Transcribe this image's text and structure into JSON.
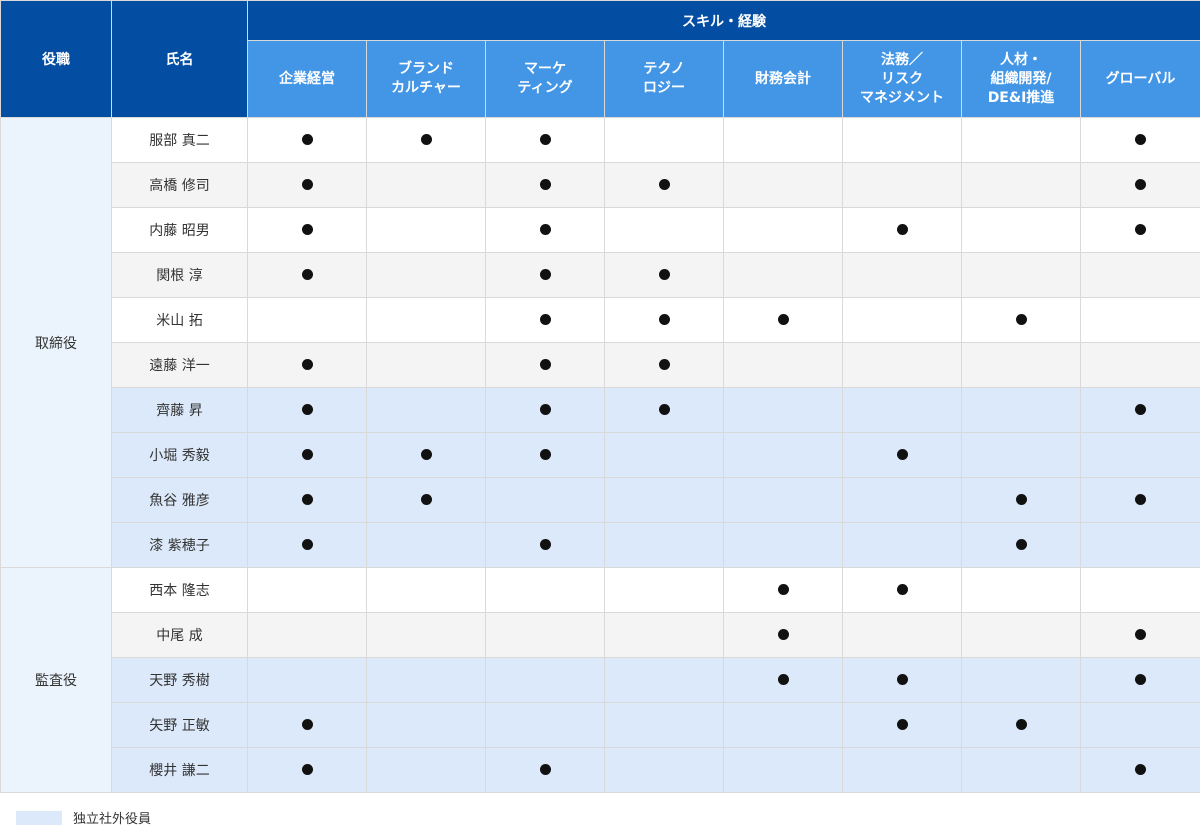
{
  "header": {
    "role_label": "役職",
    "name_label": "氏名",
    "group_label": "スキル・経験",
    "skills": [
      [
        "企業経営"
      ],
      [
        "ブランド",
        "カルチャー"
      ],
      [
        "マーケ",
        "ティング"
      ],
      [
        "テクノ",
        "ロジー"
      ],
      [
        "財務会計"
      ],
      [
        "法務／",
        "リスク",
        "マネジメント"
      ],
      [
        "人材・",
        "組織開発/",
        "DE&I推進"
      ],
      [
        "グローバル"
      ]
    ]
  },
  "mark_symbol": "●",
  "colors": {
    "header_dark": "#034ea2",
    "header_light": "#4396e6",
    "independent_fill": "#dce9fa",
    "role_fill": "#ebf4fd",
    "stripe_fill": "#f4f4f4"
  },
  "groups": [
    {
      "role": "取締役",
      "members": [
        {
          "name": "服部 真二",
          "independent": false,
          "skills": [
            1,
            1,
            1,
            0,
            0,
            0,
            0,
            1
          ]
        },
        {
          "name": "高橋 修司",
          "independent": false,
          "skills": [
            1,
            0,
            1,
            1,
            0,
            0,
            0,
            1
          ]
        },
        {
          "name": "内藤 昭男",
          "independent": false,
          "skills": [
            1,
            0,
            1,
            0,
            0,
            1,
            0,
            1
          ]
        },
        {
          "name": "関根 淳",
          "independent": false,
          "skills": [
            1,
            0,
            1,
            1,
            0,
            0,
            0,
            0
          ]
        },
        {
          "name": "米山 拓",
          "independent": false,
          "skills": [
            0,
            0,
            1,
            1,
            1,
            0,
            1,
            0
          ]
        },
        {
          "name": "遠藤 洋一",
          "independent": false,
          "skills": [
            1,
            0,
            1,
            1,
            0,
            0,
            0,
            0
          ]
        },
        {
          "name": "齊藤 昇",
          "independent": true,
          "skills": [
            1,
            0,
            1,
            1,
            0,
            0,
            0,
            1
          ]
        },
        {
          "name": "小堀 秀毅",
          "independent": true,
          "skills": [
            1,
            1,
            1,
            0,
            0,
            1,
            0,
            0
          ]
        },
        {
          "name": "魚谷 雅彦",
          "independent": true,
          "skills": [
            1,
            1,
            0,
            0,
            0,
            0,
            1,
            1
          ]
        },
        {
          "name": "漆 紫穂子",
          "independent": true,
          "skills": [
            1,
            0,
            1,
            0,
            0,
            0,
            1,
            0
          ]
        }
      ]
    },
    {
      "role": "監査役",
      "members": [
        {
          "name": "西本 隆志",
          "independent": false,
          "skills": [
            0,
            0,
            0,
            0,
            1,
            1,
            0,
            0
          ]
        },
        {
          "name": "中尾 成",
          "independent": false,
          "skills": [
            0,
            0,
            0,
            0,
            1,
            0,
            0,
            1
          ]
        },
        {
          "name": "天野 秀樹",
          "independent": true,
          "skills": [
            0,
            0,
            0,
            0,
            1,
            1,
            0,
            1
          ]
        },
        {
          "name": "矢野 正敏",
          "independent": true,
          "skills": [
            1,
            0,
            0,
            0,
            0,
            1,
            1,
            0
          ]
        },
        {
          "name": "櫻井 謙二",
          "independent": true,
          "skills": [
            1,
            0,
            1,
            0,
            0,
            0,
            0,
            1
          ]
        }
      ]
    }
  ],
  "legend": {
    "label": "独立社外役員"
  }
}
